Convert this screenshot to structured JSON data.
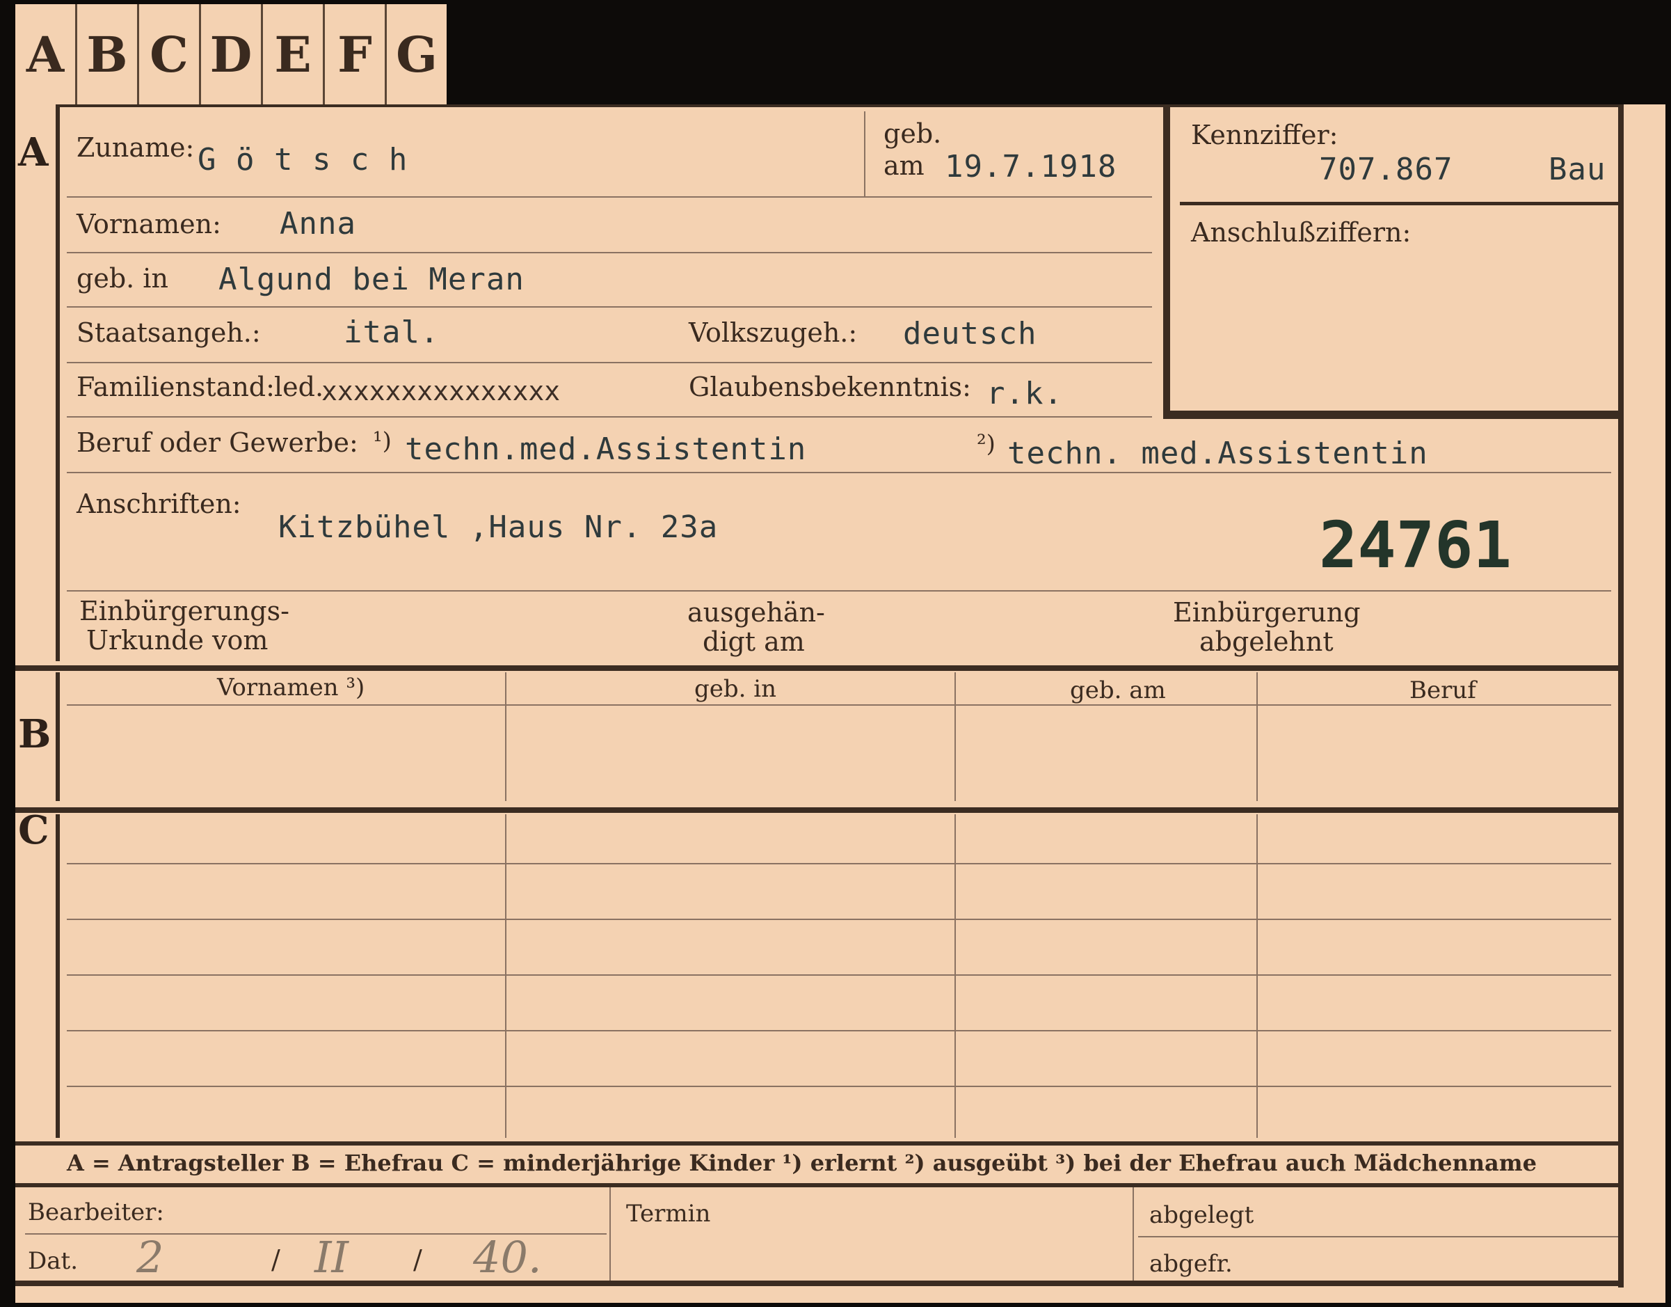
{
  "tabs": [
    "A",
    "B",
    "C",
    "D",
    "E",
    "F",
    "G"
  ],
  "sections": {
    "a": "A",
    "b": "B",
    "c": "C"
  },
  "a": {
    "zuname_label": "Zuname:",
    "zuname_value": "G ö t s c h",
    "geb_label_top": "geb.",
    "geb_label_bottom": "am",
    "geb_value": "19.7.1918",
    "kennziffer_label": "Kennziffer:",
    "kennziffer_value": "707.867",
    "kennziffer_suffix": "Bau",
    "anschluss_label": "Anschlußziffern:",
    "vornamen_label": "Vornamen:",
    "vornamen_value": "Anna",
    "gebin_label": "geb. in",
    "gebin_value": "Algund bei Meran",
    "staat_label": "Staatsangeh.:",
    "staat_value": "ital.",
    "volk_label": "Volkszugeh.:",
    "volk_value": "deutsch",
    "fam_label": "Familienstand:",
    "fam_value": "led.",
    "fam_struck": "xxxxxxxxxxxxxxx",
    "glaube_label": "Glaubensbekenntnis:",
    "glaube_value": "r.k.",
    "beruf_label": "Beruf oder Gewerbe:",
    "beruf_mark1": "¹)",
    "beruf_value1": "techn.med.Assistentin",
    "beruf_mark2": "²)",
    "beruf_value2": "techn. med.Assistentin",
    "anschriften_label": "Anschriften:",
    "anschriften_value": "Kitzbühel ,Haus Nr. 23a",
    "stamp_number": "24761",
    "einb_label_1": "Einbürgerungs-",
    "einb_label_2": "Urkunde vom",
    "ausg_label_1": "ausgehän-",
    "ausg_label_2": "digt am",
    "abgel_label_1": "Einbürgerung",
    "abgel_label_2": "abgelehnt"
  },
  "b": {
    "columns": [
      "Vornamen ³)",
      "geb. in",
      "geb. am",
      "Beruf"
    ]
  },
  "legend": "A = Antragsteller   B = Ehefrau   C = minderjährige Kinder   ¹) erlernt   ²) ausgeübt   ³) bei der Ehefrau auch Mädchenname",
  "footer": {
    "bearbeiter_label": "Bearbeiter:",
    "dat_label": "Dat.",
    "dat_day": "2",
    "dat_sep1": "/",
    "dat_month": "II",
    "dat_sep2": "/",
    "dat_year": "40.",
    "termin_label": "Termin",
    "abgelegt_label": "abgelegt",
    "abgefr_label": "abgefr."
  }
}
